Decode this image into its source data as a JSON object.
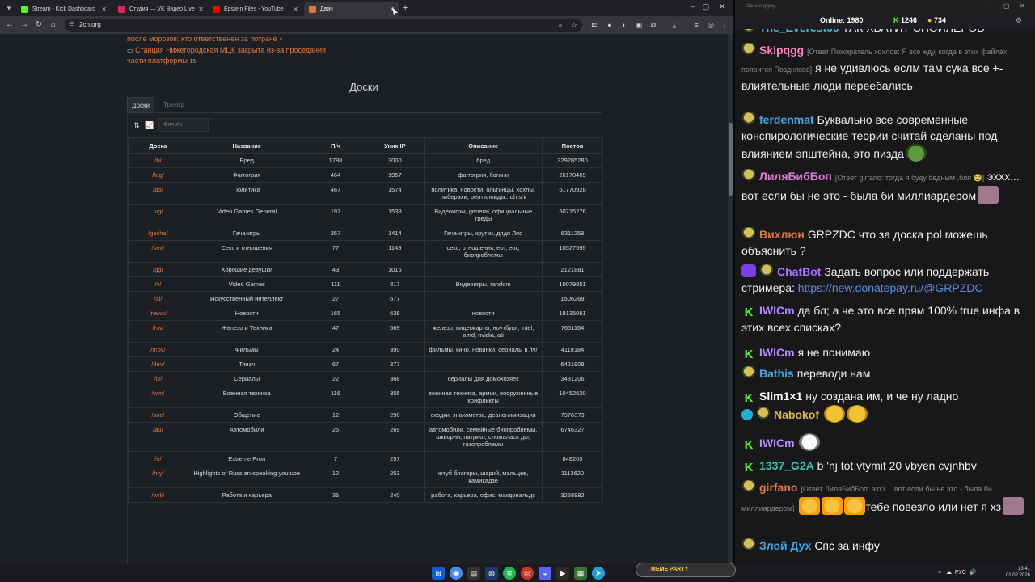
{
  "browser": {
    "tabs": [
      {
        "label": "Stream - Kick Dashboard",
        "color": "#53fc18"
      },
      {
        "label": "Студия — VK Видео Live",
        "color": "#e0245e"
      },
      {
        "label": "Epstein Files - YouTube",
        "color": "#ff0000"
      },
      {
        "label": "Двач",
        "color": "#e0773a"
      }
    ],
    "url": "2ch.org"
  },
  "news": {
    "line1": "после морозов: кто ответственен за потраче",
    "line1_count": "4",
    "line2": "Станция Нижегородская МЦК закрыта из-за проседания",
    "line3": "части платформы",
    "line3_count": "15"
  },
  "boards": {
    "title": "Доски",
    "tab_boards": "Доски",
    "tab_tracker": "Трекер",
    "filter_placeholder": "Фильтр",
    "headers": [
      "Доска",
      "Название",
      "П/ч",
      "Уник IP",
      "Описание",
      "Постов"
    ],
    "rows": [
      [
        "/b/",
        "Бред",
        "1788",
        "3000",
        "бред",
        "329285280"
      ],
      [
        "/fag/",
        "Фаггогрия",
        "464",
        "1957",
        "фаггогрия, богини",
        "26170469"
      ],
      [
        "/po/",
        "Политика",
        "467",
        "1574",
        "политика, новости, ольгинцы, хохлы, либерахи, рептилоиды.. oh shi",
        "61770928"
      ],
      [
        "/vg/",
        "Video Games General",
        "197",
        "1538",
        "Видеоигры, general, официальные треды",
        "50715276"
      ],
      [
        "/gacha/",
        "Гача-игры",
        "357",
        "1414",
        "Гача-игры, крутки, дядя Ляо",
        "6311259"
      ],
      [
        "/sex/",
        "Секс и отношения",
        "77",
        "1149",
        "секс, отношения, еот, еок, биопроблемы",
        "10527595"
      ],
      [
        "/gg/",
        "Хорошие девушки",
        "43",
        "1015",
        "",
        "2121881"
      ],
      [
        "/v/",
        "Video Games",
        "111",
        "817",
        "Видеоигры, random",
        "10079851"
      ],
      [
        "/ai/",
        "Искусственный интеллект",
        "27",
        "677",
        "",
        "1506269"
      ],
      [
        "/news/",
        "Новости",
        "165",
        "638",
        "новости",
        "19135061"
      ],
      [
        "/hw/",
        "Железо и Техника",
        "47",
        "569",
        "железо, видеокарты, ноутбуки, intel, amd, nvidia, ati",
        "7651164"
      ],
      [
        "/mov/",
        "Фильмы",
        "24",
        "390",
        "фильмы, кино, новинки, сериалы в /tv/",
        "4118184"
      ],
      [
        "/dev/",
        "Тянач",
        "67",
        "377",
        "",
        "6421908"
      ],
      [
        "/tv/",
        "Сериалы",
        "22",
        "368",
        "сериалы для домохозяек",
        "3481206"
      ],
      [
        "/wm/",
        "Военная техника",
        "116",
        "355",
        "военная техника, армии, вооруженные конфликты",
        "10452620"
      ],
      [
        "/soc/",
        "Общение",
        "12",
        "290",
        "сходки, знакомства, деанонимизация",
        "7376373"
      ],
      [
        "/au/",
        "Автомобили",
        "25",
        "269",
        "автомобили, семейные биопроблемы, шкворни, патриот, сломалась дсг, газопроблемы",
        "6746327"
      ],
      [
        "/e/",
        "Extreme Pron",
        "7",
        "257",
        "",
        "848265"
      ],
      [
        "/hry/",
        "Highlights of Russian-speaking youtube",
        "12",
        "253",
        "ютуб блогеры, шарий, мальцев, камикадзе",
        "1113620"
      ],
      [
        "/wrk/",
        "Работа и карьера",
        "35",
        "240",
        "работа, карьера, офис, макдональдс",
        "3258982"
      ]
    ]
  },
  "chat": {
    "window_title": "Окно в дурку",
    "online_label": "Online:",
    "online": "1980",
    "kick_count": "1246",
    "twitch_count": "734",
    "messages": [
      {
        "user": "The_Everest00",
        "color": "#3ec1d3",
        "text": "ТАК ХВАТИТ СПОЙЛЕРОВ",
        "reply": ""
      },
      {
        "user": "Skipqgg",
        "color": "#ff7fbf",
        "text": "я не удивлюсь еслм там сука все +- влиятельные люди переебались",
        "reply": "[Ответ Пожиратель хохлов: Я все жду, когда в этих файлах появится Поздняков]"
      },
      {
        "user": "ferdenmat",
        "color": "#3fa8e0",
        "text": "Буквально все современные конспирологические теории считай сделаны под влиянием эпштейна, это пизда",
        "reply": ""
      },
      {
        "user": "ЛиляБибБоп",
        "color": "#e07bd6",
        "text": "эххх... вот если бы не это - была би миллиардером",
        "reply": "[Ответ girfano: тогда я буду бедным ,бля 😂]"
      },
      {
        "user": "Вихлюн",
        "color": "#e0773a",
        "text": "GRPZDC что за доска pol можешь объяснить ?",
        "reply": ""
      },
      {
        "user": "ChatBot",
        "color": "#a970ff",
        "text": "Задать вопрос или поддержать стримера:",
        "link": "https://new.donatepay.ru/@GRPZDC",
        "reply": ""
      },
      {
        "user": "IWICm",
        "color": "#b38bff",
        "text": "да бл; а че это все прям 100% true инфа в этих всех списках?",
        "reply": ""
      },
      {
        "user": "IWICm",
        "color": "#b38bff",
        "text": "я не понимаю",
        "reply": ""
      },
      {
        "user": "Bathis",
        "color": "#3fa8e0",
        "text": "переводи нам",
        "reply": ""
      },
      {
        "user": "Slim1×1",
        "color": "#ffffff",
        "text": "ну создана им, и че ну ладно",
        "reply": ""
      },
      {
        "user": "Nabokof",
        "color": "#e0b84a",
        "text": "",
        "reply": ""
      },
      {
        "user": "IWICm",
        "color": "#b38bff",
        "text": "",
        "reply": ""
      },
      {
        "user": "1337_G2A",
        "color": "#3ec1a0",
        "text": "b 'nj tot vtymit 20 vbyen cvjnhbv",
        "reply": ""
      },
      {
        "user": "girfano",
        "color": "#e0773a",
        "text": "тебе повезло или нет я хз",
        "reply": "[Ответ ЛиляБибБоп: эххх... вот если бы не это - была би миллиардером]"
      },
      {
        "user": "Злой Дух",
        "color": "#3fa8e0",
        "text": "Спс за инфу",
        "reply": ""
      }
    ]
  },
  "taskbar": {
    "lang": "РУС",
    "time": "13:41",
    "date": "01.02.2026",
    "meme": "MEME PARTY"
  }
}
